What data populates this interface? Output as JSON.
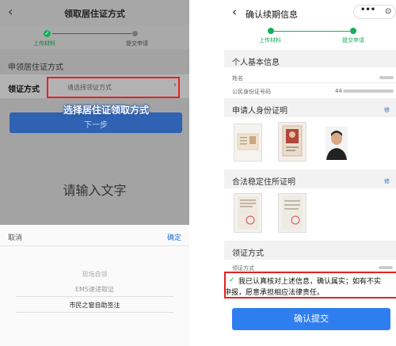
{
  "left": {
    "title": "领取居住证方式",
    "back_icon": "‹",
    "steps": [
      "上传材料",
      "提交申请"
    ],
    "step_check": "✓",
    "section_label": "申领居住证方式",
    "row_label": "领证方式",
    "row_placeholder": "请选择领证方式",
    "row_chevron": "›",
    "annotation": "选择居住证领取方式",
    "next_button": "下一步",
    "input_hint": "请输入文字",
    "sheet": {
      "cancel": "取消",
      "confirm": "确定",
      "options": [
        "现场自领",
        "EMS速递取证",
        "市民之窗自助签注"
      ]
    },
    "colors": {
      "accent_green": "#1aad5c",
      "highlight_red": "#e52222",
      "primary_blue": "#2f62b2"
    }
  },
  "right": {
    "back_icon": "‹",
    "title": "确认续期信息",
    "capsule_dots": "•••",
    "capsule_circle": "⊙",
    "steps": [
      "上传材料",
      "提交申请"
    ],
    "sections": {
      "basic_info": "个人基本信息",
      "identity_proof": "申请人身份证明",
      "residence_proof": "合法稳定住所证明",
      "collection": "领证方式"
    },
    "more_link": "修",
    "fields": {
      "name": "姓名",
      "id_number": "公民身份证号码",
      "id_prefix": "44",
      "collection_method": "领证方式"
    },
    "declaration_line1": "我已认真核对上述信息，确认属实；如有不实",
    "declaration_line2": "申报，愿意承担相应法律责任。",
    "check_icon": "✓",
    "submit_button": "确认提交",
    "colors": {
      "accent_green": "#1aad5c",
      "highlight_red": "#e52222",
      "primary_blue": "#2f7ef0"
    }
  }
}
